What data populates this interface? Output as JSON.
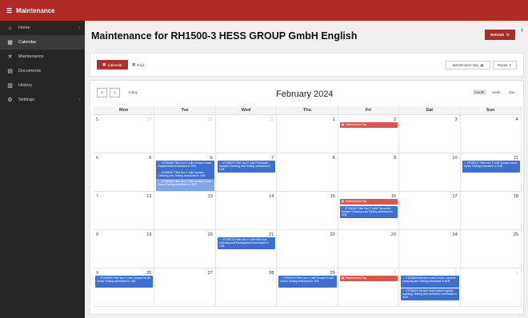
{
  "app": {
    "title": "Maintenance"
  },
  "sidebar": {
    "items": [
      {
        "label": "Home",
        "icon": "home-icon",
        "glyph": "⌂",
        "active": false,
        "chevron": true
      },
      {
        "label": "Calendar",
        "icon": "calendar-icon",
        "glyph": "▦",
        "active": true,
        "chevron": false
      },
      {
        "label": "Maintenance",
        "icon": "wrench-icon",
        "glyph": "✕",
        "active": false,
        "chevron": false
      },
      {
        "label": "Documents",
        "icon": "document-icon",
        "glyph": "▤",
        "active": false,
        "chevron": false
      },
      {
        "label": "History",
        "icon": "history-icon",
        "glyph": "▥",
        "active": false,
        "chevron": false
      },
      {
        "label": "Settings",
        "icon": "settings-icon",
        "glyph": "⚙",
        "active": false,
        "chevron": true
      }
    ]
  },
  "header": {
    "title": "Maintenance for RH1500-3 HESS GROUP GmbH English",
    "refresh_label": "Refresh"
  },
  "toolbar": {
    "calendar_label": "Calendar",
    "grid_label": "Grid",
    "maintenance_day_label": "Maintenance Day",
    "repair_label": "Repair"
  },
  "calendar": {
    "month_label": "February 2024",
    "today_label": "today",
    "views": [
      "month",
      "week",
      "day"
    ],
    "active_view": "month",
    "weekdays": [
      "Mon",
      "Tue",
      "Wed",
      "Thu",
      "Fri",
      "Sat",
      "Sun"
    ],
    "weeks": [
      {
        "week": "5",
        "days": [
          {
            "n": "29",
            "other": true
          },
          {
            "n": "30",
            "other": true
          },
          {
            "n": "31",
            "other": true
          },
          {
            "n": "1"
          },
          {
            "n": "2"
          },
          {
            "n": "3"
          },
          {
            "n": "4"
          }
        ]
      },
      {
        "week": "6",
        "days": [
          {
            "n": "5"
          },
          {
            "n": "6"
          },
          {
            "n": "7"
          },
          {
            "n": "8"
          },
          {
            "n": "9"
          },
          {
            "n": "10"
          },
          {
            "n": "11"
          }
        ]
      },
      {
        "week": "7",
        "days": [
          {
            "n": "12"
          },
          {
            "n": "13"
          },
          {
            "n": "14"
          },
          {
            "n": "15"
          },
          {
            "n": "16"
          },
          {
            "n": "17"
          },
          {
            "n": "18"
          }
        ]
      },
      {
        "week": "8",
        "days": [
          {
            "n": "19"
          },
          {
            "n": "20"
          },
          {
            "n": "21"
          },
          {
            "n": "22"
          },
          {
            "n": "23"
          },
          {
            "n": "24"
          },
          {
            "n": "25"
          }
        ]
      },
      {
        "week": "9",
        "days": [
          {
            "n": "26"
          },
          {
            "n": "27"
          },
          {
            "n": "28"
          },
          {
            "n": "29"
          },
          {
            "n": "1",
            "other": true
          },
          {
            "n": "2",
            "other": true
          },
          {
            "n": "3",
            "other": true
          }
        ]
      }
    ],
    "events": [
      {
        "week": 0,
        "day": 4,
        "slot": 0,
        "kind": "red",
        "text": "Maintenance Day"
      },
      {
        "week": 1,
        "day": 1,
        "slot": 0,
        "kind": "blue",
        "text": "#T038468 Filter box F-rolle Scraper brush Replacement scheduled in 1KB"
      },
      {
        "week": 1,
        "day": 1,
        "slot": 1,
        "kind": "blue",
        "text": "#T038467 Filter box F-rolle System Cleaning and Testing scheduled in 1KB"
      },
      {
        "week": 1,
        "day": 1,
        "slot": 2,
        "kind": "lblue",
        "text": "#T038466 Filter box F-rolle Scraper brush Screw Testing scheduled in 1KB"
      },
      {
        "week": 1,
        "day": 2,
        "slot": 0,
        "kind": "blue",
        "text": "#T038433 Filter box F-rolle Pneumatic Scraper Cleaning and Testing scheduled in 1CB"
      },
      {
        "week": 1,
        "day": 6,
        "slot": 0,
        "kind": "blue",
        "text": "#T038312 Filter box F-rolle Scraper brush Screw Testing scheduled in 1HB"
      },
      {
        "week": 2,
        "day": 4,
        "slot": 0,
        "kind": "red",
        "text": "Maintenance Day"
      },
      {
        "week": 2,
        "day": 4,
        "slot": 1,
        "kind": "blue",
        "text": "#T038183 Filter box F-rolle Pneumatic Scraper Cleaning and Testing scheduled in 2KB"
      },
      {
        "week": 3,
        "day": 2,
        "slot": 0,
        "kind": "blue",
        "text": "#T038278 Filter box F-rolle Filter box Cleaning and Readjustment scheduled in 1CB"
      },
      {
        "week": 4,
        "day": 0,
        "slot": 0,
        "kind": "blue",
        "text": "#T038259 Filter box F-rolle Scraper brush Screw Testing scheduled in 1KB"
      },
      {
        "week": 4,
        "day": 3,
        "slot": 0,
        "kind": "blue",
        "text": "#T038219 Filter box F-rolle Scraper brush Screw Testing scheduled in 1KB"
      },
      {
        "week": 4,
        "day": 4,
        "slot": 0,
        "kind": "red",
        "text": "Maintenance Day"
      },
      {
        "week": 4,
        "day": 5,
        "slot": 0,
        "kind": "blue",
        "text": "#T038903 Machine frame Guide columns Cleaning and Testing scheduled in 4KB"
      },
      {
        "week": 4,
        "day": 5,
        "slot": 1,
        "kind": "blue",
        "text": "#T038621 Scraper head System (guide bushing) Testing and lubrication scheduled in 4CB"
      }
    ]
  }
}
